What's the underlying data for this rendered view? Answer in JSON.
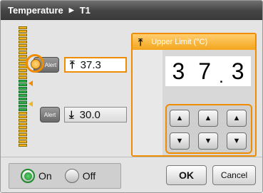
{
  "title": {
    "screen": "Temperature",
    "separator_icon": "right-triangle-icon",
    "channel": "T1"
  },
  "alerts": {
    "upper": {
      "button_label": "Alert",
      "icon": "upper-limit-icon",
      "value": "37.3"
    },
    "lower": {
      "button_label": "Alert",
      "icon": "lower-limit-icon",
      "value": "30.0"
    }
  },
  "upper_limit_panel": {
    "title": "Upper Limit (°C)",
    "icon": "upper-limit-icon",
    "digits": [
      "3",
      "7",
      ".",
      "3"
    ],
    "up_icon": "up-arrow-icon",
    "down_icon": "down-arrow-icon"
  },
  "footer": {
    "on_label": "On",
    "off_label": "Off",
    "selected": "On",
    "ok_label": "OK",
    "cancel_label": "Cancel"
  },
  "colors": {
    "accent": "#f08c00",
    "bar_yellow": "#f3b51c",
    "bar_green": "#2fae4a"
  }
}
